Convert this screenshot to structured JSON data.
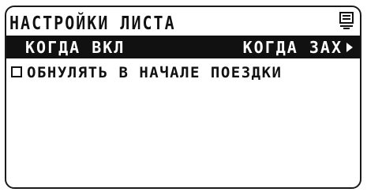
{
  "screen": {
    "title": "НАСТРОЙКИ ЛИСТА",
    "page_icon": "page-icon"
  },
  "trigger": {
    "left_label": "КОГДА ВКЛ",
    "right_label": "КОГДА ЗАХ",
    "arrow_icon": "arrow-right-icon"
  },
  "option": {
    "checked": false,
    "label": "ОБНУЛЯТЬ В НАЧАЛЕ ПОЕЗДКИ"
  }
}
